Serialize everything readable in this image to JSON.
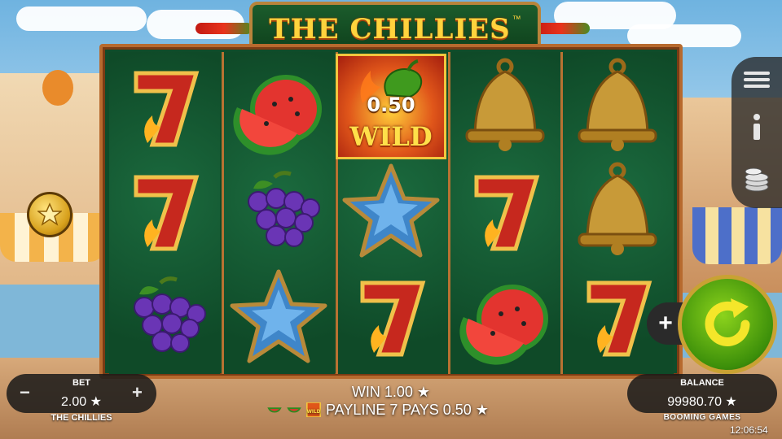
{
  "game": {
    "title": "THE CHILLIES",
    "trademark": "™"
  },
  "reels": [
    [
      "seven",
      "seven",
      "grapes"
    ],
    [
      "watermelon",
      "grapes",
      "star"
    ],
    [
      "wild",
      "star",
      "seven"
    ],
    [
      "bell",
      "seven",
      "watermelon"
    ],
    [
      "bell",
      "bell",
      "seven"
    ]
  ],
  "wild": {
    "value": "0.50",
    "label": "WILD"
  },
  "bet": {
    "label": "BET",
    "value": "2.00 ★",
    "minus": "−",
    "plus": "+"
  },
  "balance": {
    "label": "BALANCE",
    "value": "99980.70 ★"
  },
  "win": {
    "text": "WIN 1.00 ★",
    "payline_text": "PAYLINE 7 PAYS 0.50 ★",
    "payline_symbols": [
      "watermelon",
      "watermelon",
      "wild"
    ]
  },
  "footer": {
    "game_name": "THE CHILLIES",
    "brand": "BOOMING GAMES",
    "clock": "12:06:54"
  },
  "controls": {
    "menu_icons": [
      "hamburger-icon",
      "info-icon",
      "coins-icon"
    ],
    "spin_icon": "spin-arrow-icon",
    "autoplay_plus": "+",
    "bonus_icon": "star-coin-icon"
  }
}
